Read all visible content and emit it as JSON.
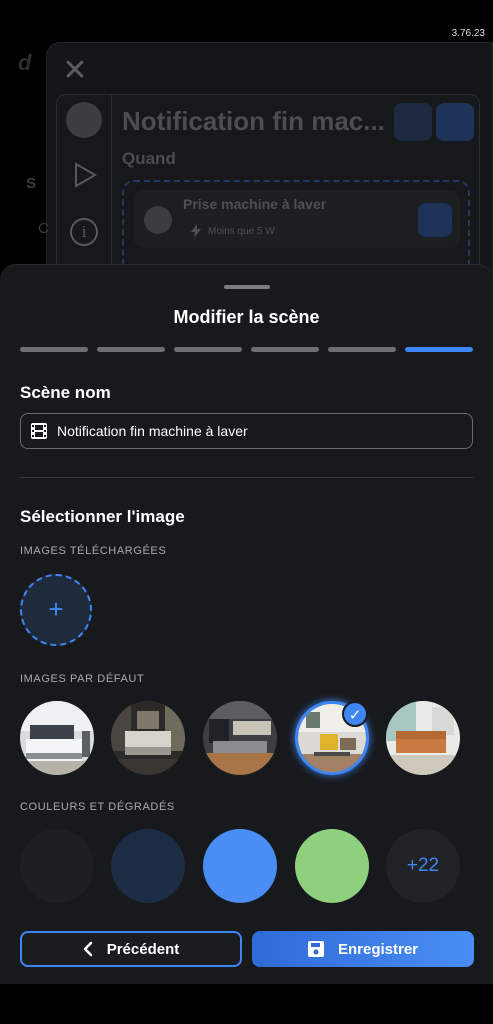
{
  "status": {
    "version": "3.76.23"
  },
  "background": {
    "scene_title": "Notification fin mac...",
    "section_when": "Quand",
    "trigger": {
      "title": "Prise machine à laver",
      "condition": "Moins que 5 W"
    }
  },
  "sheet": {
    "title": "Modifier la scène",
    "steps": [
      false,
      false,
      false,
      false,
      false,
      true
    ],
    "name_section": "Scène nom",
    "name_value": "Notification fin machine à laver",
    "image_section": "Sélectionner l'image",
    "uploaded_caption": "IMAGES TÉLÉCHARGÉES",
    "upload_symbol": "+",
    "defaults_caption": "IMAGES PAR DÉFAUT",
    "default_images": [
      {
        "name": "bedroom",
        "selected": false
      },
      {
        "name": "dark-bedroom",
        "selected": false
      },
      {
        "name": "kitchen",
        "selected": false
      },
      {
        "name": "living-room-yellow-chair",
        "selected": true
      },
      {
        "name": "living-room-orange-sofa",
        "selected": false
      }
    ],
    "colors_caption": "COULEURS ET DÉGRADÉS",
    "colors": [
      "#1d1f22",
      "#1c2c45",
      "#4a8ef5",
      "#8fd07f"
    ],
    "more_colors": "+22",
    "prev_button": "Précédent",
    "save_button": "Enregistrer"
  }
}
